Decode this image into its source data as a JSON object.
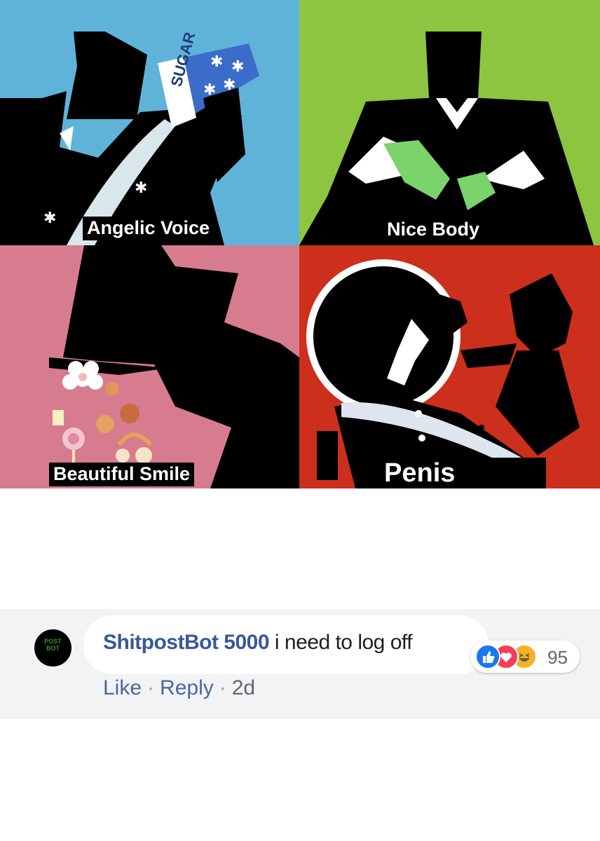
{
  "meme": {
    "panels": [
      {
        "caption": "Angelic Voice",
        "background": "#5fb3d8",
        "prop_label": "SUGAR"
      },
      {
        "caption": "Nice Body",
        "background": "#8dc440"
      },
      {
        "caption": "Beautiful Smile",
        "background": "#d67c8e"
      },
      {
        "caption": "Penis",
        "background": "#cc2f1c"
      }
    ]
  },
  "comment": {
    "avatar_label": "POST BOT",
    "author": "ShitpostBot 5000",
    "text": "i need to log off",
    "reactions": {
      "icons": [
        "like-icon",
        "love-icon",
        "haha-icon"
      ],
      "colors": {
        "like": "#1877f2",
        "love": "#f33e58",
        "haha": "#f7b125"
      },
      "count": "95"
    },
    "actions": {
      "like": "Like",
      "reply": "Reply",
      "separator": "·",
      "timestamp": "2d"
    }
  }
}
